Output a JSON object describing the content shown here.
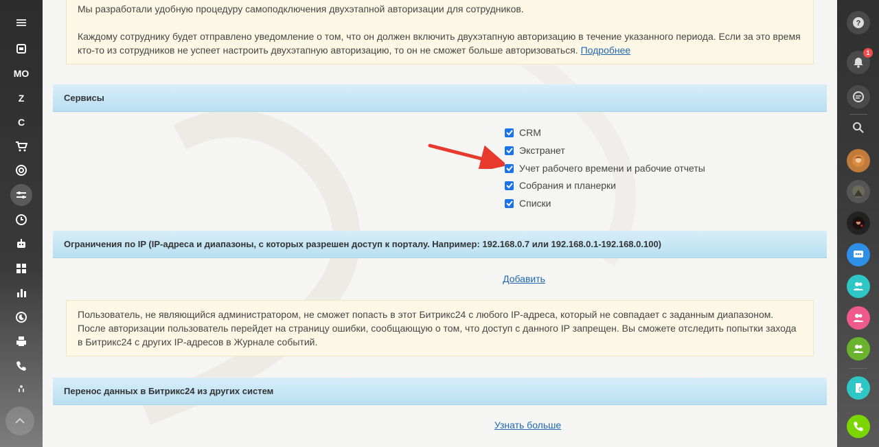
{
  "left_sidebar": {
    "items": [
      {
        "name": "menu-icon",
        "label": ""
      },
      {
        "name": "sync-icon",
        "label": ""
      },
      {
        "name": "mo-item",
        "label": "МО"
      },
      {
        "name": "z-item",
        "label": "Z"
      },
      {
        "name": "c-item",
        "label": "C"
      },
      {
        "name": "cart-icon",
        "label": ""
      },
      {
        "name": "target-icon",
        "label": ""
      },
      {
        "name": "settings-sliders-icon",
        "label": ""
      },
      {
        "name": "clock-icon",
        "label": ""
      },
      {
        "name": "robot-icon",
        "label": ""
      },
      {
        "name": "grid-icon",
        "label": ""
      },
      {
        "name": "bar-chart-icon",
        "label": ""
      },
      {
        "name": "moon-clock-icon",
        "label": ""
      },
      {
        "name": "printer-icon",
        "label": ""
      },
      {
        "name": "phone-icon",
        "label": ""
      },
      {
        "name": "small-icon",
        "label": ""
      }
    ]
  },
  "two_factor_notice": {
    "line1": "Мы разработали удобную процедуру самоподключения двухэтапной авторизации для сотрудников.",
    "line2": "Каждому сотруднику будет отправлено уведомление о том, что он должен включить двухэтапную авторизацию в течение указанного периода. Если за это время кто-то из сотрудников не успеет настроить двухэтапную авторизацию, то он не сможет больше авторизоваться.",
    "more_link": "Подробнее"
  },
  "services": {
    "title": "Сервисы",
    "items": [
      {
        "label": "CRM",
        "checked": true
      },
      {
        "label": "Экстранет",
        "checked": true
      },
      {
        "label": "Учет рабочего времени и рабочие отчеты",
        "checked": true
      },
      {
        "label": "Собрания и планерки",
        "checked": true
      },
      {
        "label": "Списки",
        "checked": true
      }
    ]
  },
  "ip_restrictions": {
    "title": "Ограничения по IP (IP-адреса и диапазоны, с которых разрешен доступ к порталу. Например: 192.168.0.7 или 192.168.0.1-192.168.0.100)",
    "add_link": "Добавить",
    "notice": "Пользователь, не являющийся администратором, не сможет попасть в этот Битрикс24 с любого IP-адреса, который не совпадает с заданным диапазоном. После авторизации пользователь перейдет на страницу ошибки, сообщающую о том, что доступ с данного IP запрещен. Вы сможете отследить попытки захода в Битрикс24 с других IP-адресов в Журнале событий."
  },
  "migration": {
    "title": "Перенос данных в Битрикс24 из других систем",
    "learn_more_link": "Узнать больше"
  },
  "right_sidebar": {
    "notifications_count": "1",
    "colors": {
      "teal": "#2fc6c6",
      "pink": "#f0598b",
      "green": "#6ab42d",
      "blue": "#2d8fe6",
      "call_green": "#7bd500"
    }
  }
}
